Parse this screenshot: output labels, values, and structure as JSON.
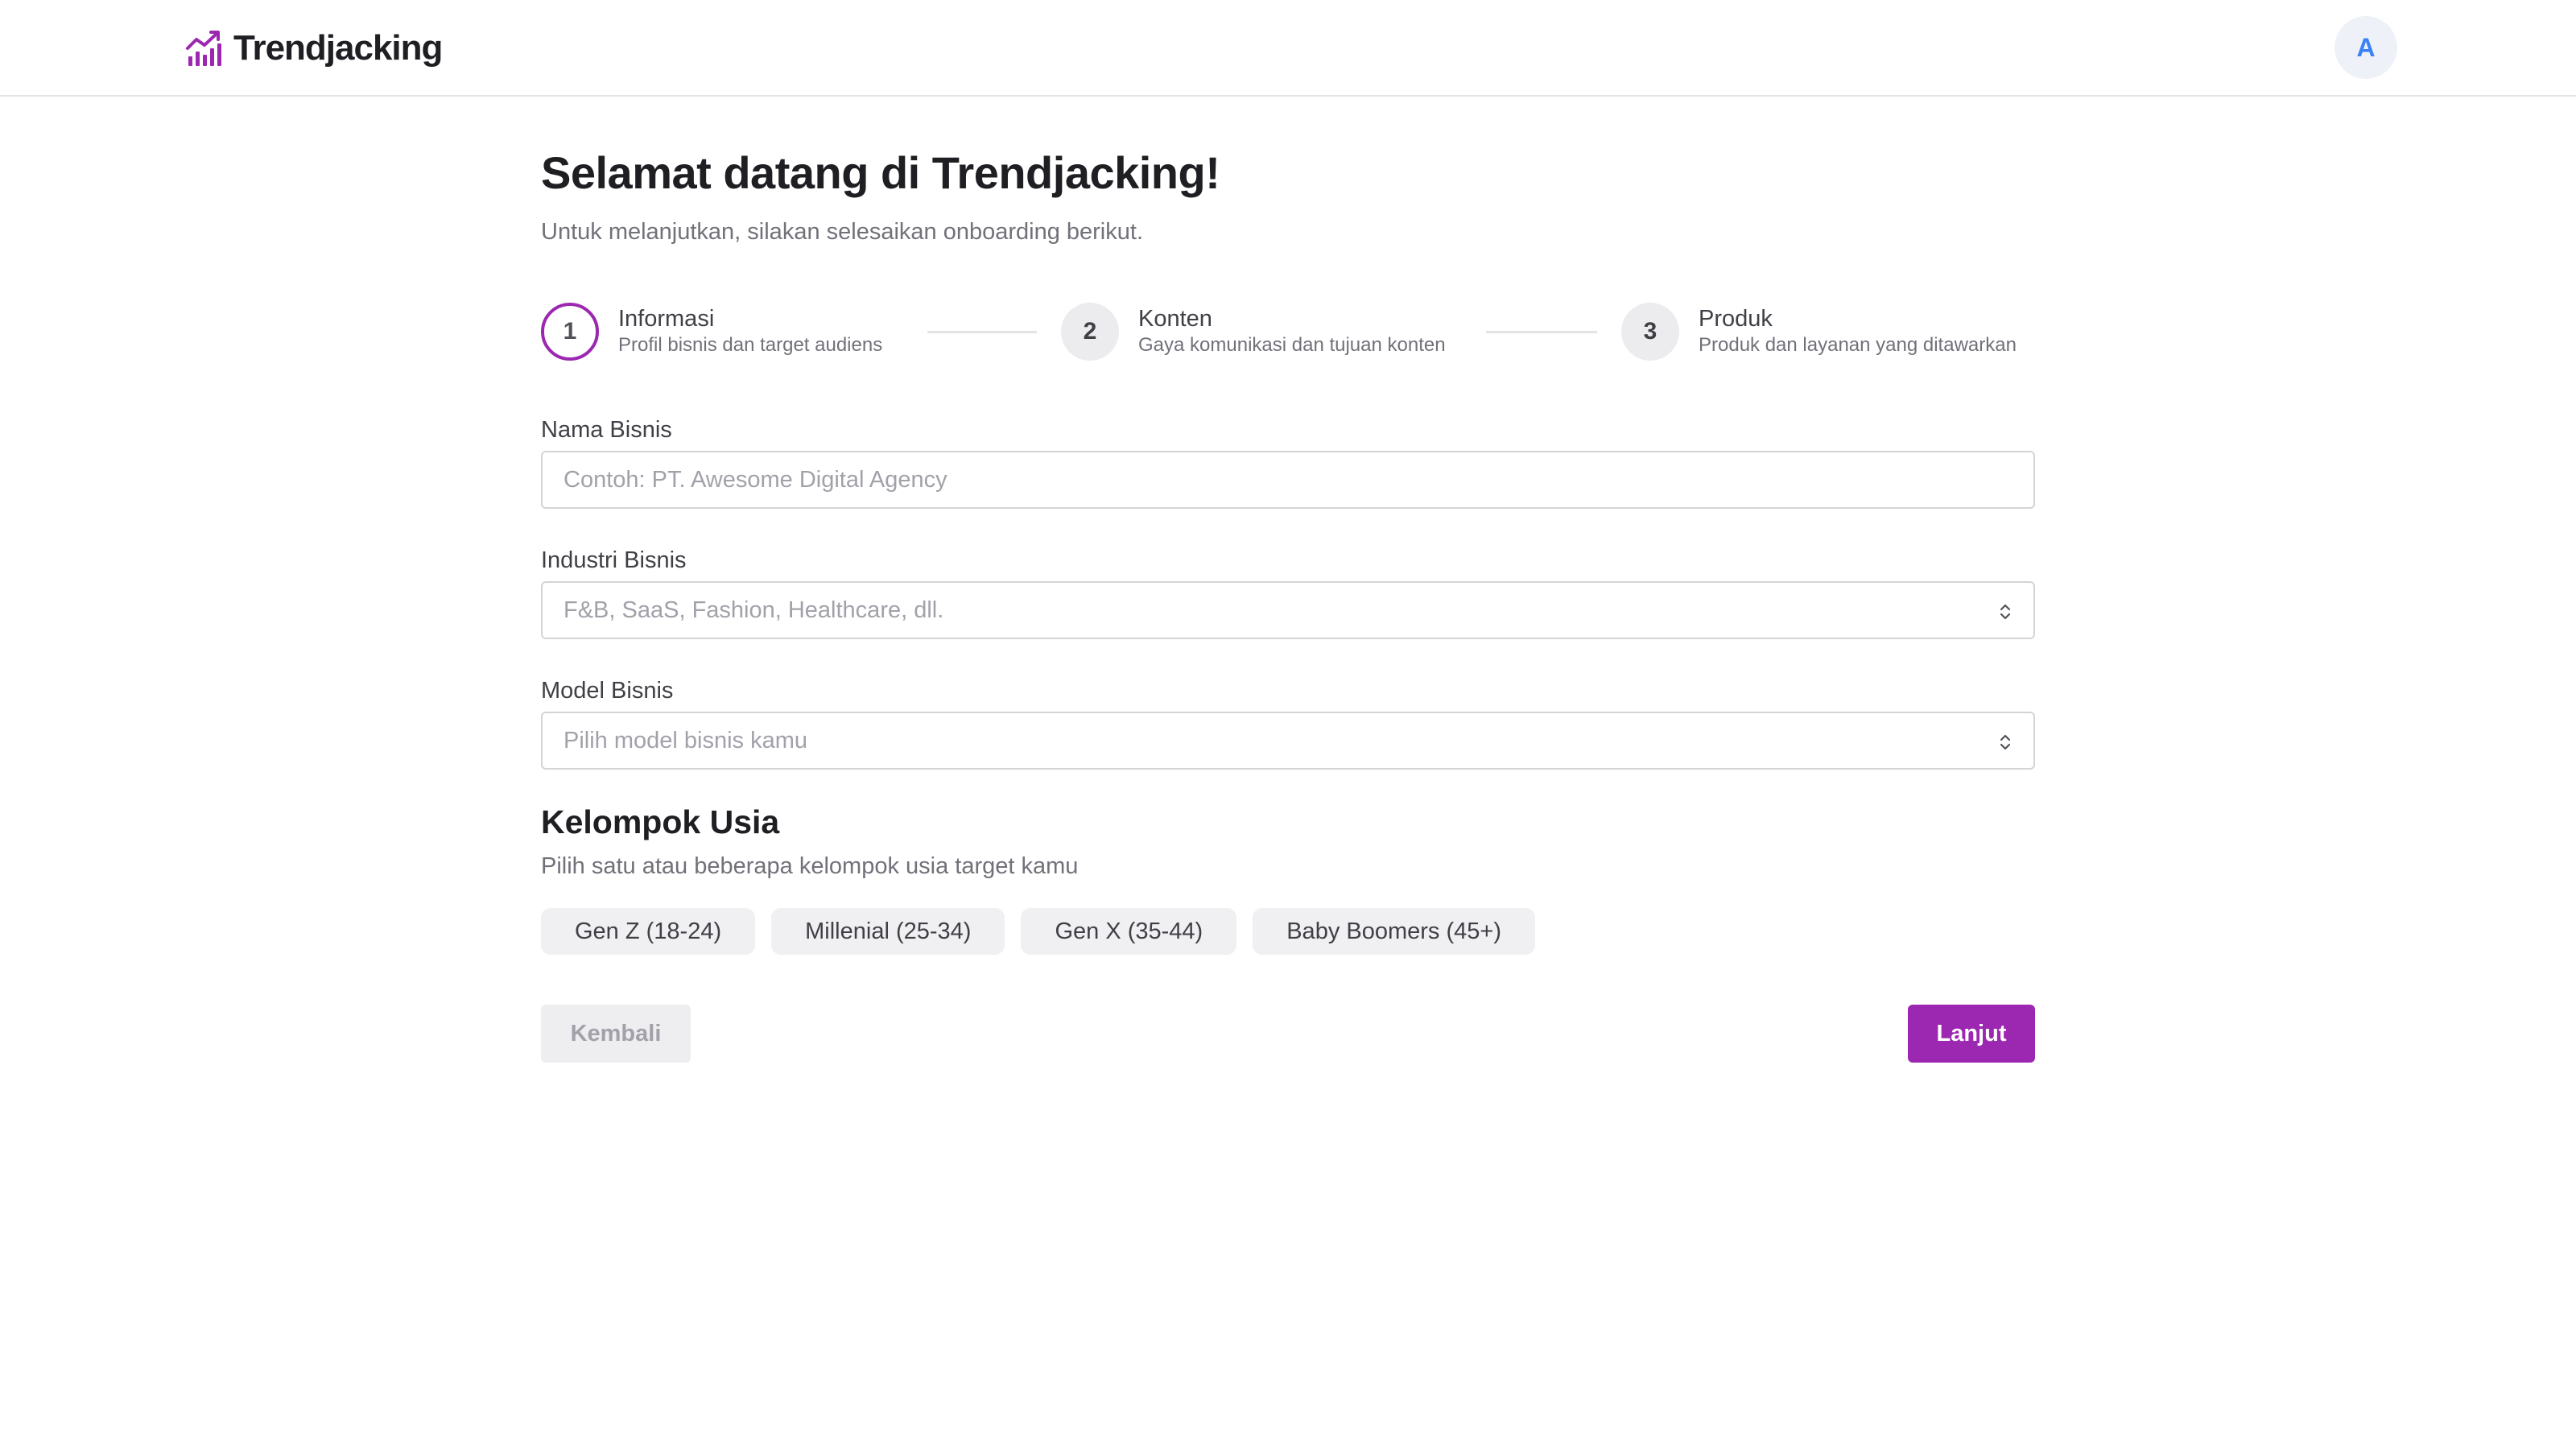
{
  "header": {
    "brand_name": "Trendjacking",
    "avatar_initial": "A"
  },
  "page": {
    "title": "Selamat datang di Trendjacking!",
    "subtitle": "Untuk melanjutkan, silakan selesaikan onboarding berikut."
  },
  "stepper": {
    "steps": [
      {
        "number": "1",
        "title": "Informasi",
        "desc": "Profil bisnis dan target audiens",
        "state": "active"
      },
      {
        "number": "2",
        "title": "Konten",
        "desc": "Gaya komunikasi dan tujuan konten",
        "state": "inactive"
      },
      {
        "number": "3",
        "title": "Produk",
        "desc": "Produk dan layanan yang ditawarkan",
        "state": "inactive"
      }
    ]
  },
  "form": {
    "business_name": {
      "label": "Nama Bisnis",
      "value": "",
      "placeholder": "Contoh: PT. Awesome Digital Agency"
    },
    "industry": {
      "label": "Industri Bisnis",
      "placeholder": "F&B, SaaS, Fashion, Healthcare, dll."
    },
    "business_model": {
      "label": "Model Bisnis",
      "placeholder": "Pilih model bisnis kamu"
    }
  },
  "age_group": {
    "title": "Kelompok Usia",
    "desc": "Pilih satu atau beberapa kelompok usia target kamu",
    "options": [
      "Gen Z (18-24)",
      "Millenial (25-34)",
      "Gen X (35-44)",
      "Baby Boomers (45+)"
    ]
  },
  "actions": {
    "back_label": "Kembali",
    "next_label": "Lanjut"
  },
  "colors": {
    "accent": "#9c27b0",
    "avatar_bg": "#eef2f8",
    "avatar_text": "#3b82f6"
  },
  "icons": {
    "brand": "trending-up-chart-icon",
    "select": "chevron-up-down-icon"
  }
}
